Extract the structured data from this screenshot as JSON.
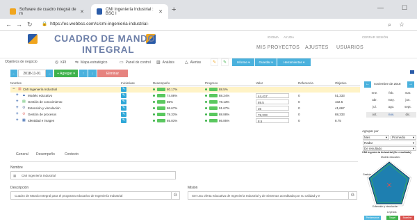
{
  "browser": {
    "tabs": [
      {
        "title": "Software de cuadro integral de m"
      },
      {
        "title": "CMI Ingeniería Industrial : BSC I"
      }
    ],
    "url": "https://es.webbsc.com/s/cmi-ingenieria-industrial-"
  },
  "header": {
    "brand_line1": "CUADRO DE MANDO",
    "brand_line2": "INTEGRAL",
    "top_links": [
      "IDIOMA",
      "AYUDA",
      "CERRAR SESIÓN"
    ],
    "nav": [
      "MIS PROYECTOS",
      "AJUSTES",
      "USUARIOS"
    ]
  },
  "toolbar": {
    "tabs": [
      {
        "icon": "",
        "label": "Objetivos de negocio"
      },
      {
        "icon": "kpi-icon",
        "label": "KPI"
      },
      {
        "icon": "map-icon",
        "label": "Mapa estratégico"
      },
      {
        "icon": "dashboard-icon",
        "label": "Panel de control"
      },
      {
        "icon": "analysis-icon",
        "label": "Análisis"
      },
      {
        "icon": "bell-icon",
        "label": "Alertas"
      }
    ],
    "buttons": [
      "Informe ▾",
      "Guardar ▾",
      "Herramientas ▾"
    ]
  },
  "actions": {
    "date": "2018-11-01",
    "add_label": "+ Agregar ▾",
    "delete_label": "Eliminar"
  },
  "table": {
    "headers": [
      "Nombre",
      "Iniciativas",
      "Desempeño",
      "Progreso",
      "Valor",
      "Referencia",
      "Objetivo"
    ],
    "rows": [
      {
        "name": "CMI Ingeniería Industrial",
        "desempeno": "80.17%",
        "progreso": "88.5%",
        "valor": "",
        "referencia": "",
        "objetivo": ""
      },
      {
        "name": "Modelo educativo",
        "desempeno": "74.88%",
        "progreso": "88.24%",
        "valor": "44,417",
        "referencia": "0",
        "objetivo": "51,333"
      },
      {
        "name": "Gestión de conocimiento",
        "desempeno": "85%",
        "progreso": "78.13%",
        "valor": "89.5",
        "referencia": "0",
        "objetivo": "102.5"
      },
      {
        "name": "Extensión y vinculación",
        "desempeno": "86.67%",
        "progreso": "91.67%",
        "valor": "35",
        "referencia": "0",
        "objetivo": "41,667"
      },
      {
        "name": "Gestión de procesos",
        "desempeno": "78.33%",
        "progreso": "88.88%",
        "valor": "78,333",
        "referencia": "0",
        "objetivo": "88,333"
      },
      {
        "name": "Identidad e imagen",
        "desempeno": "85.83%",
        "progreso": "86.85%",
        "valor": "8.5",
        "referencia": "0",
        "objetivo": "8.75"
      }
    ]
  },
  "detail": {
    "tabs": [
      "General",
      "Desempeño",
      "Contexto"
    ],
    "nombre_label": "Nombre",
    "nombre_value": "CMI Ingeniería Industrial",
    "descripcion_label": "Descripción",
    "descripcion_value": "Cuadro de Mando Integral para el programa educativo de Ingeniería Industrial",
    "mision_label": "Misión",
    "mision_value": "Ser una oferta educativa de Ingeniería Industrial y de Sistemas acreditada por su calidad y e"
  },
  "calendar": {
    "month": "noviembre de 2018",
    "months": [
      "ene.",
      "feb.",
      "mar.",
      "abr.",
      "may.",
      "jun.",
      "jul.",
      "ago.",
      "sept.",
      "oct.",
      "nov.",
      "dic."
    ]
  },
  "side": {
    "group_label": "Agrupar por",
    "group_values": [
      "Mes",
      "Promedio"
    ],
    "radar_label": "Radar",
    "result_label": "De resultado",
    "chart_title": "CMI Ingeniería Industrial (De resultado)",
    "chart_axis_top": "Modelo educativo",
    "chart_axis_left": "Gestión",
    "chart_axis_bottom": "Extensión y vinculación",
    "legend_title": "Leyenda",
    "legend": [
      {
        "label": "Performance",
        "color": "#4fb7e0"
      },
      {
        "label": "Target",
        "color": "#3eb24b"
      },
      {
        "label": "Baseline",
        "color": "#d9534f"
      }
    ]
  }
}
